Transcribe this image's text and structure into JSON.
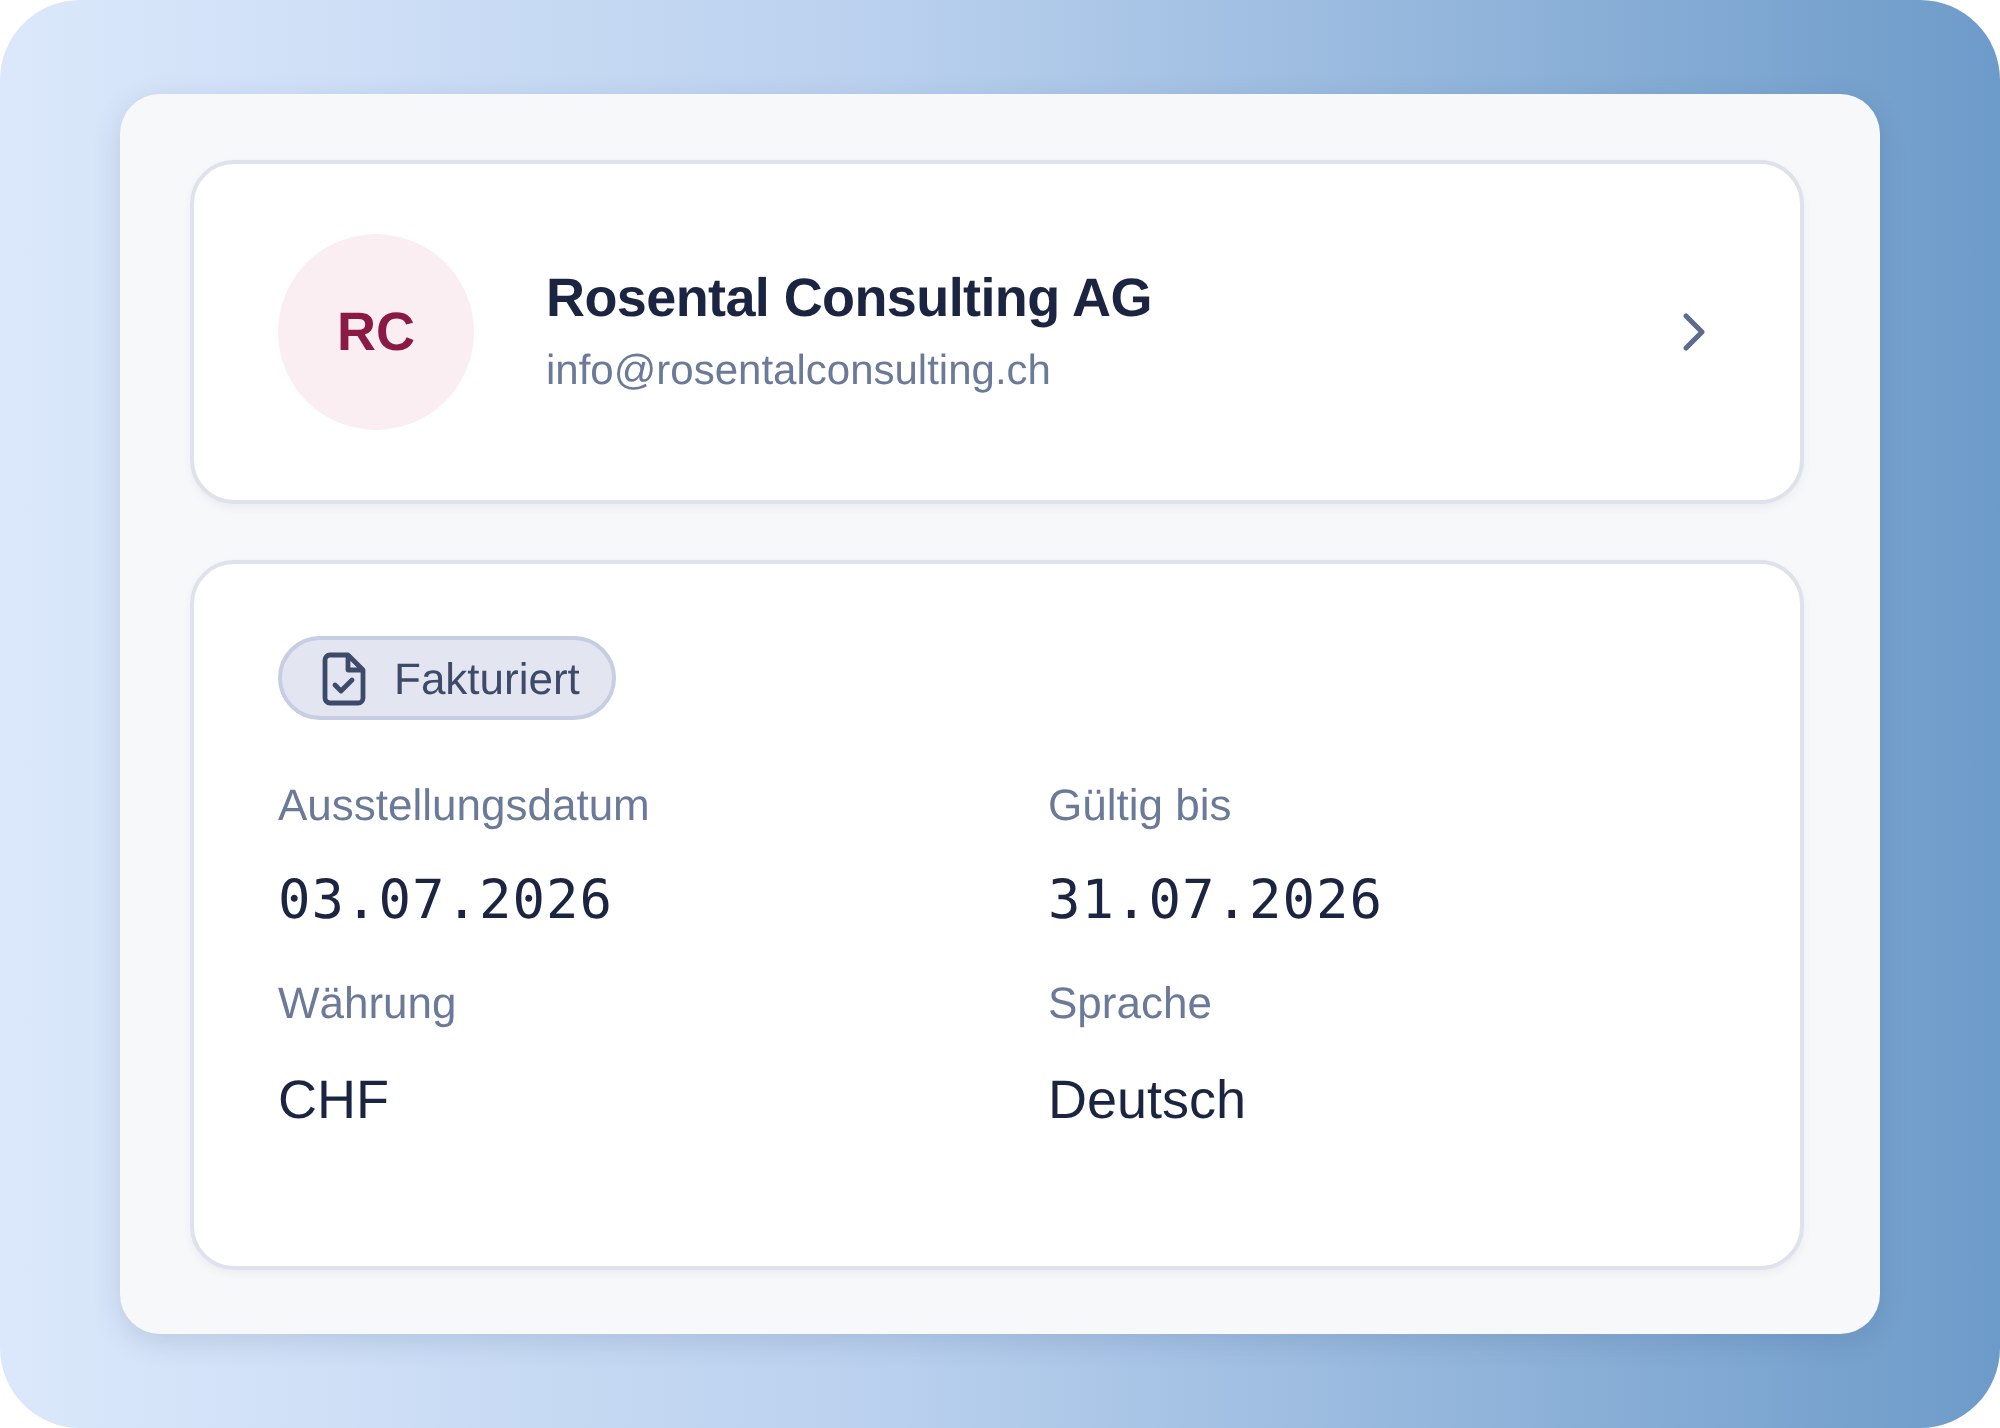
{
  "customer": {
    "initials": "RC",
    "name": "Rosental Consulting AG",
    "email": "info@rosentalconsulting.ch"
  },
  "status_badge": {
    "label": "Fakturiert"
  },
  "fields": [
    {
      "label": "Ausstellungsdatum",
      "value": "03.07.2026",
      "kind": "date"
    },
    {
      "label": "Gültig bis",
      "value": "31.07.2026",
      "kind": "date"
    },
    {
      "label": "Währung",
      "value": "CHF",
      "kind": "text"
    },
    {
      "label": "Sprache",
      "value": "Deutsch",
      "kind": "text"
    }
  ]
}
